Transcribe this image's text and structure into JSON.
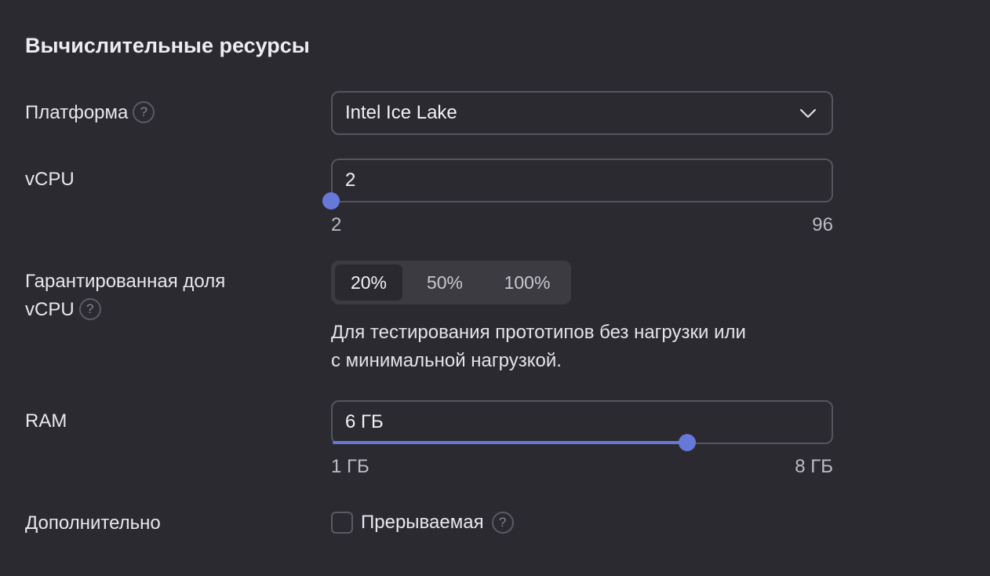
{
  "section": {
    "title": "Вычислительные ресурсы"
  },
  "platform": {
    "label": "Платформа",
    "help_icon": "question-circle-icon",
    "value": "Intel Ice Lake",
    "dropdown_icon": "chevron-down-icon"
  },
  "vcpu": {
    "label": "vCPU",
    "value": "2",
    "min_label": "2",
    "max_label": "96",
    "min": 2,
    "max": 96,
    "current": 2,
    "accent_color": "#6779d8"
  },
  "core_fraction": {
    "label_line1": "Гарантированная доля",
    "label_line2": "vCPU",
    "help_icon": "question-circle-icon",
    "options": [
      "20%",
      "50%",
      "100%"
    ],
    "selected": "20%",
    "description_line1": "Для тестирования прототипов без нагрузки или",
    "description_line2": "с минимальной нагрузкой."
  },
  "ram": {
    "label": "RAM",
    "value": "6 ГБ",
    "min_label": "1 ГБ",
    "max_label": "8 ГБ",
    "min": 1,
    "max": 8,
    "current": 6,
    "accent_color": "#6779d8"
  },
  "additional": {
    "label": "Дополнительно",
    "preemptible_label": "Прерываемая",
    "preemptible_checked": false,
    "help_icon": "question-circle-icon"
  }
}
